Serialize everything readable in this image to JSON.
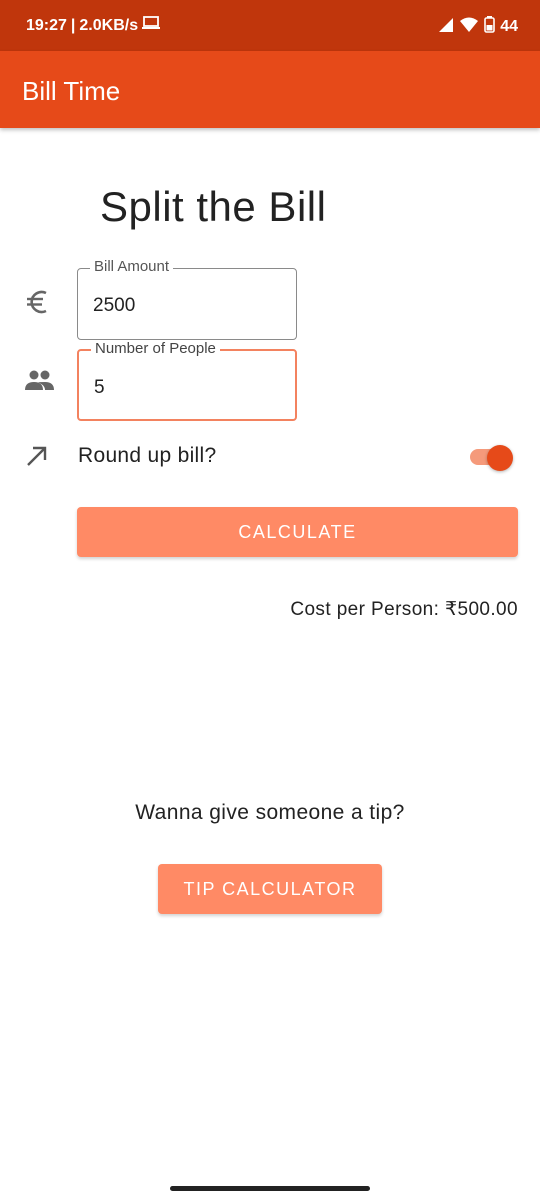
{
  "status_bar": {
    "time": "19:27",
    "separator": "|",
    "network_speed": "2.0KB/s",
    "battery_level": "44"
  },
  "app_bar": {
    "title": "Bill Time"
  },
  "main": {
    "heading": "Split the Bill",
    "bill_amount": {
      "label": "Bill Amount",
      "value": "2500",
      "icon": "euro-icon"
    },
    "people": {
      "label": "Number of People",
      "value": "5",
      "icon": "people-icon"
    },
    "round_up": {
      "label": "Round up bill?",
      "icon": "arrow-up-right-icon",
      "enabled": true
    },
    "calculate_label": "CALCULATE",
    "result_text": "Cost per Person: ₹500.00",
    "tip_question": "Wanna give someone a tip?",
    "tip_button_label": "TIP CALCULATOR"
  },
  "colors": {
    "status_bar": "#c0360c",
    "app_bar": "#e64a19",
    "button": "#ff8a65",
    "active_border": "#f3825f"
  }
}
